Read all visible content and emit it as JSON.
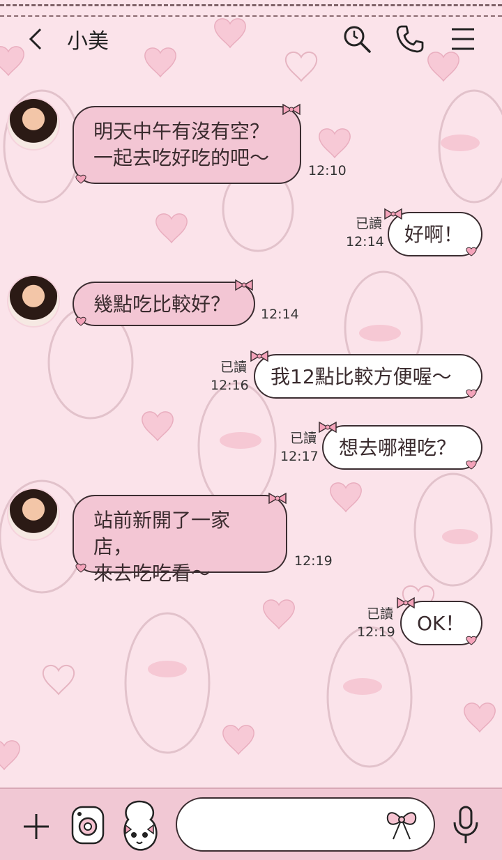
{
  "header": {
    "title": "小美",
    "back_icon": "chevron-left-icon",
    "icons": [
      "search-history-icon",
      "phone-icon",
      "menu-icon"
    ]
  },
  "messages": [
    {
      "side": "in",
      "text": "明天中午有沒有空？\n一起去吃好吃的吧～",
      "time": "12:10"
    },
    {
      "side": "out",
      "text": "好啊！",
      "read": "已讀",
      "time": "12:14"
    },
    {
      "side": "in",
      "text": "幾點吃比較好？",
      "time": "12:14"
    },
    {
      "side": "out",
      "text": "我12點比較方便喔～",
      "read": "已讀",
      "time": "12:16"
    },
    {
      "side": "out",
      "text": "想去哪裡吃？",
      "read": "已讀",
      "time": "12:17"
    },
    {
      "side": "in",
      "text": "站前新開了一家店，\n來去吃吃看～",
      "time": "12:19"
    },
    {
      "side": "out",
      "text": "OK！",
      "read": "已讀",
      "time": "12:19"
    }
  ],
  "bottom_bar": {
    "icons": [
      "plus-icon",
      "camera-icon",
      "sticker-icon",
      "ribbon-icon",
      "microphone-icon"
    ],
    "input_value": ""
  },
  "colors": {
    "background": "#fbe3ea",
    "incoming_bubble": "#f3c6d4",
    "outgoing_bubble": "#ffffff",
    "bottom_bar": "#f1c8d4"
  }
}
